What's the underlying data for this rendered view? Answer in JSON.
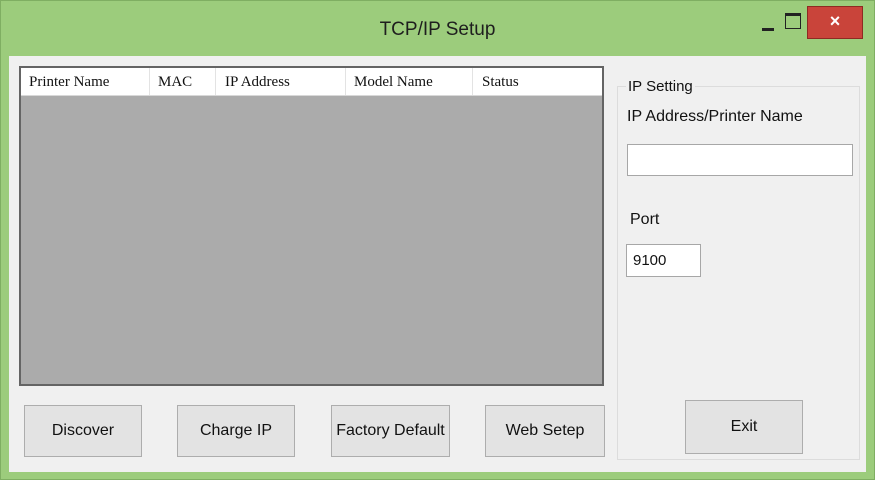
{
  "window": {
    "title": "TCP/IP Setup",
    "close_glyph": "×",
    "colors": {
      "frame": "#9ccc7c",
      "close": "#c9443a",
      "client": "#f0f0f0",
      "list_body": "#ababab"
    }
  },
  "printer_list": {
    "columns": [
      "Printer Name",
      "MAC",
      "IP Address",
      "Model Name",
      "Status"
    ],
    "rows": []
  },
  "buttons": {
    "discover": "Discover",
    "charge_ip": "Charge IP",
    "factory_default": "Factory Default",
    "web_setep": "Web Setep",
    "exit": "Exit"
  },
  "ip_setting": {
    "group_label": "IP Setting",
    "address_label": "IP Address/Printer Name",
    "address_value": "",
    "port_label": "Port",
    "port_value": "9100"
  },
  "icons": {
    "minimize": "minimize-icon",
    "maximize": "maximize-icon",
    "close": "close-icon"
  }
}
